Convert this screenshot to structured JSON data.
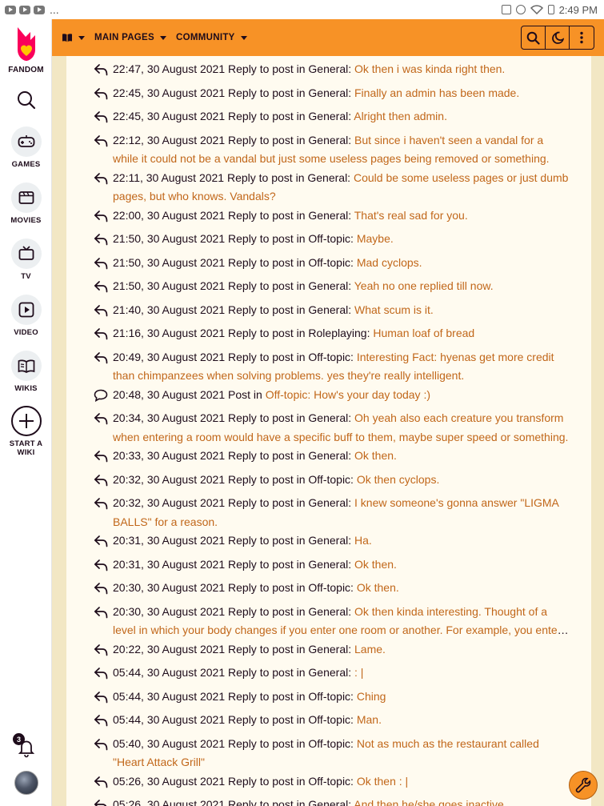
{
  "status_bar": {
    "more": "...",
    "time": "2:49 PM"
  },
  "rail": {
    "brand": "FANDOM",
    "items": [
      {
        "label": "GAMES"
      },
      {
        "label": "MOVIES"
      },
      {
        "label": "TV"
      },
      {
        "label": "VIDEO"
      },
      {
        "label": "WIKIS"
      },
      {
        "label": "START A WIKI"
      }
    ],
    "notifications_count": "3"
  },
  "nav": {
    "main_pages": "MAIN PAGES",
    "community": "COMMUNITY"
  },
  "entries": [
    {
      "type": "reply",
      "time": "22:47, 30 August 2021",
      "action": "Reply to post in",
      "board": "General",
      "snippet": "Ok then i was kinda right then."
    },
    {
      "type": "reply",
      "time": "22:45, 30 August 2021",
      "action": "Reply to post in",
      "board": "General",
      "snippet": "Finally an admin has been made."
    },
    {
      "type": "reply",
      "time": "22:45, 30 August 2021",
      "action": "Reply to post in",
      "board": "General",
      "snippet": "Alright then admin."
    },
    {
      "type": "reply",
      "time": "22:12, 30 August 2021",
      "action": "Reply to post in",
      "board": "General",
      "snippet": "But since i haven't seen a vandal for a while it could not be a vandal but just some useless pages being removed or something."
    },
    {
      "type": "reply",
      "time": "22:11, 30 August 2021",
      "action": "Reply to post in",
      "board": "General",
      "snippet": "Could be some useless pages or just dumb pages, but who knows. Vandals?"
    },
    {
      "type": "reply",
      "time": "22:00, 30 August 2021",
      "action": "Reply to post in",
      "board": "General",
      "snippet": "That's real sad for you."
    },
    {
      "type": "reply",
      "time": "21:50, 30 August 2021",
      "action": "Reply to post in",
      "board": "Off-topic",
      "snippet": "Maybe."
    },
    {
      "type": "reply",
      "time": "21:50, 30 August 2021",
      "action": "Reply to post in",
      "board": "Off-topic",
      "snippet": "Mad cyclops."
    },
    {
      "type": "reply",
      "time": "21:50, 30 August 2021",
      "action": "Reply to post in",
      "board": "General",
      "snippet": "Yeah no one replied till now."
    },
    {
      "type": "reply",
      "time": "21:40, 30 August 2021",
      "action": "Reply to post in",
      "board": "General",
      "snippet": "What scum is it."
    },
    {
      "type": "reply",
      "time": "21:16, 30 August 2021",
      "action": "Reply to post in",
      "board": "Roleplaying",
      "snippet": "Human loaf of bread"
    },
    {
      "type": "reply",
      "time": "20:49, 30 August 2021",
      "action": "Reply to post in",
      "board": "Off-topic",
      "snippet": "Interesting Fact: hyenas get more credit than chimpanzees when solving problems. yes they're really intelligent."
    },
    {
      "type": "post",
      "time": "20:48, 30 August 2021",
      "action": "Post in",
      "board": "Off-topic",
      "snippet": "How's your day today :)"
    },
    {
      "type": "reply",
      "time": "20:34, 30 August 2021",
      "action": "Reply to post in",
      "board": "General",
      "snippet": "Oh yeah also each creature you transform when entering a room would have a specific buff to them, maybe super speed or something."
    },
    {
      "type": "reply",
      "time": "20:33, 30 August 2021",
      "action": "Reply to post in",
      "board": "General",
      "snippet": "Ok then."
    },
    {
      "type": "reply",
      "time": "20:32, 30 August 2021",
      "action": "Reply to post in",
      "board": "Off-topic",
      "snippet": "Ok then cyclops."
    },
    {
      "type": "reply",
      "time": "20:32, 30 August 2021",
      "action": "Reply to post in",
      "board": "General",
      "snippet": "I knew someone's gonna answer \"LIGMA BALLS\" for a reason."
    },
    {
      "type": "reply",
      "time": "20:31, 30 August 2021",
      "action": "Reply to post in",
      "board": "General",
      "snippet": "Ha."
    },
    {
      "type": "reply",
      "time": "20:31, 30 August 2021",
      "action": "Reply to post in",
      "board": "General",
      "snippet": "Ok then."
    },
    {
      "type": "reply",
      "time": "20:30, 30 August 2021",
      "action": "Reply to post in",
      "board": "Off-topic",
      "snippet": "Ok then."
    },
    {
      "type": "reply",
      "time": "20:30, 30 August 2021",
      "action": "Reply to post in",
      "board": "General",
      "snippet": "Ok then kinda interesting. Thought of a level in which your body changes if you enter one room or another. For example, you enter a room and become a creature."
    },
    {
      "type": "reply",
      "time": "20:22, 30 August 2021",
      "action": "Reply to post in",
      "board": "General",
      "snippet": "Lame."
    },
    {
      "type": "reply",
      "time": "05:44, 30 August 2021",
      "action": "Reply to post in",
      "board": "General",
      "snippet": ": |"
    },
    {
      "type": "reply",
      "time": "05:44, 30 August 2021",
      "action": "Reply to post in",
      "board": "Off-topic",
      "snippet": "Ching"
    },
    {
      "type": "reply",
      "time": "05:44, 30 August 2021",
      "action": "Reply to post in",
      "board": "Off-topic",
      "snippet": "Man."
    },
    {
      "type": "reply",
      "time": "05:40, 30 August 2021",
      "action": "Reply to post in",
      "board": "Off-topic",
      "snippet": "Not as much as the restaurant called \"Heart Attack Grill\""
    },
    {
      "type": "reply",
      "time": "05:26, 30 August 2021",
      "action": "Reply to post in",
      "board": "Off-topic",
      "snippet": "Ok then : |"
    },
    {
      "type": "reply",
      "time": "05:26, 30 August 2021",
      "action": "Reply to post in",
      "board": "General",
      "snippet": "And then he/she goes inactive."
    }
  ],
  "colors": {
    "accent": "#f79226",
    "link": "#c1671a",
    "text": "#1e0c1b",
    "background": "#f2e7c4"
  }
}
